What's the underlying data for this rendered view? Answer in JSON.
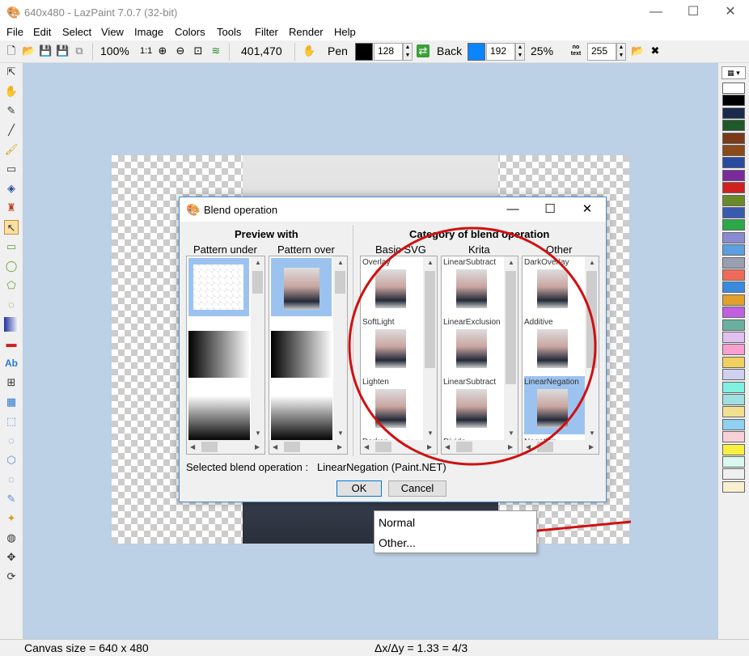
{
  "window": {
    "title": "640x480 - LazPaint 7.0.7 (32-bit)"
  },
  "menu": [
    "File",
    "Edit",
    "Select",
    "View",
    "Image",
    "Colors",
    "Tools",
    "Filter",
    "Render",
    "Help"
  ],
  "toolbar": {
    "zoom": "100%",
    "zoom_1to1": "1:1",
    "coords": "401,470",
    "pen_label": "Pen",
    "pen_alpha": "128",
    "back_label": "Back",
    "back_alpha": "192",
    "tolerance": "25%",
    "mode_label": "no text",
    "opacity": "255",
    "pen_color": "#000000",
    "back_color": "#0a84ff"
  },
  "dialog": {
    "title": "Blend operation",
    "preview_header": "Preview with",
    "pattern_under": "Pattern under",
    "pattern_over": "Pattern over",
    "category_header": "Category of blend operation",
    "cat_basic": "Basic SVG",
    "cat_krita": "Krita",
    "cat_other": "Other",
    "basic_items": [
      "Overlay",
      "SoftLight",
      "Lighten",
      "Darken"
    ],
    "krita_items": [
      "LinearSubtract",
      "LinearExclusion",
      "LinearSubtract",
      "Divide"
    ],
    "other_items": [
      "DarkOverlay",
      "Additive",
      "LinearNegation",
      "Negation"
    ],
    "selected_label": "Selected blend operation :",
    "selected_value": "LinearNegation (Paint.NET)",
    "ok": "OK",
    "cancel": "Cancel"
  },
  "context_menu": {
    "normal": "Normal",
    "other": "Other..."
  },
  "status": {
    "canvas": "Canvas size = 640 x 480",
    "ratio": "Δx/Δy = 1.33 = 4/3"
  },
  "palette": [
    "#ffffff",
    "#000000",
    "#1a2a4a",
    "#1f5a2a",
    "#7a3a1a",
    "#8a4a1a",
    "#2a4aa0",
    "#7a2a9a",
    "#d02020",
    "#6a8a2a",
    "#3a5ab0",
    "#2aa84a",
    "#8a8ad0",
    "#5aa0e0",
    "#9aa0b0",
    "#f06a5a",
    "#3a8ae0",
    "#e0a02a",
    "#c060e0",
    "#6ab0a0",
    "#e0c0f0",
    "#f8a0d0",
    "#f0d060",
    "#d0d0f0",
    "#80f0e0",
    "#a0e0e0",
    "#f0e090",
    "#90d0f0",
    "#f8d0d8",
    "#f8f040",
    "#d8f8f0",
    "#f0f0f0",
    "#f8f0d0"
  ]
}
